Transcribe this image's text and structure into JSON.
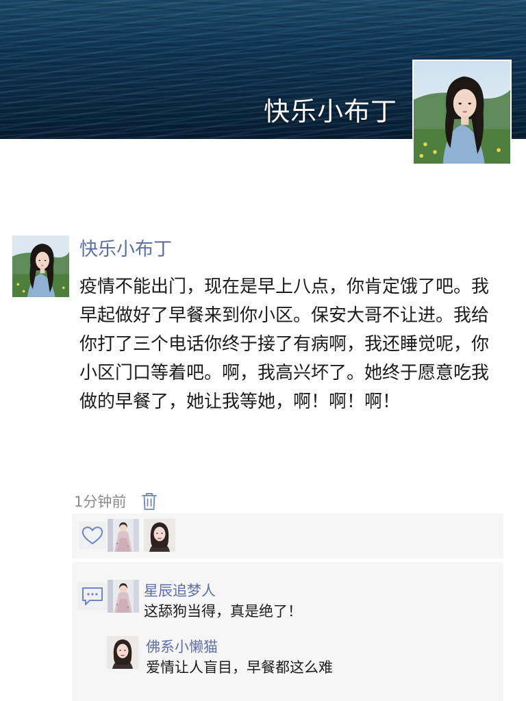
{
  "cover": {
    "username": "快乐小布丁"
  },
  "post": {
    "author": "快乐小布丁",
    "content": "疫情不能出门，现在是早上八点，你肯定饿了吧。我早起做好了早餐来到你小区。保安大哥不让进。我给你打了三个电话你终于接了有病啊，我还睡觉呢，你小区门口等着吧。啊，我高兴坏了。她终于愿意吃我做的早餐了，她让我等她，啊！啊！啊！",
    "time": "1分钟前"
  },
  "likes": {
    "icon": "heart-outline-icon",
    "avatars": [
      "avatar-dress-woman",
      "avatar-woman-portrait"
    ]
  },
  "comments": [
    {
      "author": "星辰追梦人",
      "text": "这舔狗当得，真是绝了！",
      "avatar": "avatar-dress-woman"
    },
    {
      "author": "佛系小懒猫",
      "text": "爱情让人盲目，早餐都这么难",
      "avatar": "avatar-woman-portrait"
    }
  ],
  "colors": {
    "name_link": "#5b6fae",
    "body_text": "#1b1b1b",
    "meta_text": "#8a8a8a",
    "panel_bg": "#f6f6f6",
    "icon_blue": "#6b86c4"
  }
}
